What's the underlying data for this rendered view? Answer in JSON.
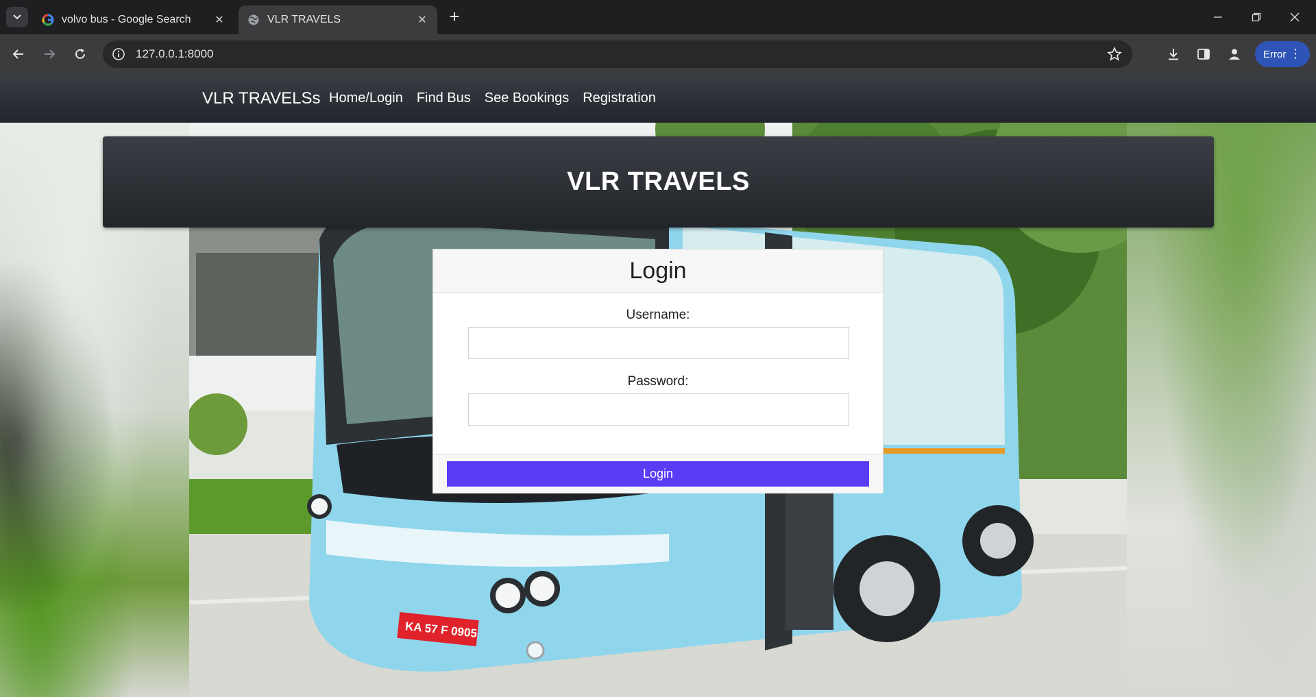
{
  "browser": {
    "tabs": [
      {
        "title": "volvo bus - Google Search",
        "favicon": "google-g-icon",
        "active": false
      },
      {
        "title": "VLR TRAVELS",
        "favicon": "globe-icon",
        "active": true
      }
    ],
    "address": "127.0.0.1:8000",
    "profile_status": "Error",
    "accent_color": "#2d54b6"
  },
  "site": {
    "brand": "VLR TRAVELSs",
    "nav": [
      {
        "label": "Home/Login"
      },
      {
        "label": "Find Bus"
      },
      {
        "label": "See Bookings"
      },
      {
        "label": "Registration"
      }
    ],
    "banner_title": "VLR TRAVELS"
  },
  "login": {
    "title": "Login",
    "username_label": "Username:",
    "username_value": "",
    "password_label": "Password:",
    "password_value": "",
    "submit_label": "Login",
    "button_color": "#5b3cf5"
  },
  "background": {
    "plate_text": "KA 57 F 0905"
  }
}
